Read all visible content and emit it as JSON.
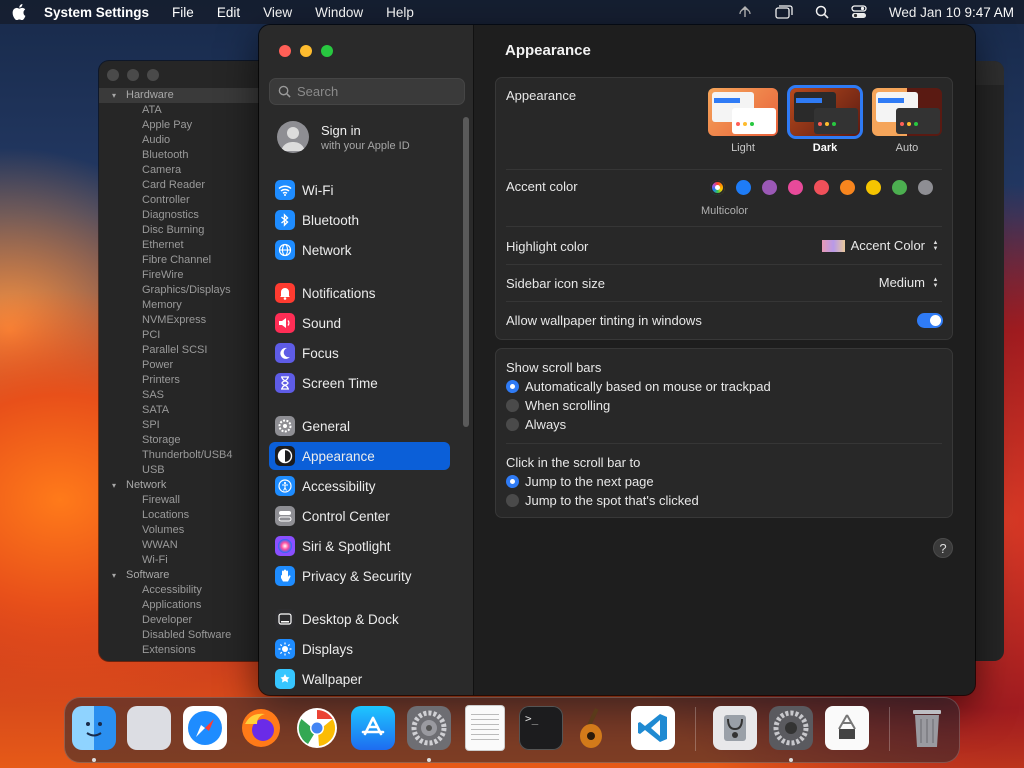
{
  "menubar": {
    "app_name": "System Settings",
    "menus": [
      "File",
      "Edit",
      "View",
      "Window",
      "Help"
    ],
    "clock": "Wed Jan 10  9:47 AM"
  },
  "system_info": {
    "sections": [
      {
        "label": "Hardware",
        "items": [
          "ATA",
          "Apple Pay",
          "Audio",
          "Bluetooth",
          "Camera",
          "Card Reader",
          "Controller",
          "Diagnostics",
          "Disc Burning",
          "Ethernet",
          "Fibre Channel",
          "FireWire",
          "Graphics/Displays",
          "Memory",
          "NVMExpress",
          "PCI",
          "Parallel SCSI",
          "Power",
          "Printers",
          "SAS",
          "SATA",
          "SPI",
          "Storage",
          "Thunderbolt/USB4",
          "USB"
        ]
      },
      {
        "label": "Network",
        "items": [
          "Firewall",
          "Locations",
          "Volumes",
          "WWAN",
          "Wi-Fi"
        ]
      },
      {
        "label": "Software",
        "items": [
          "Accessibility",
          "Applications",
          "Developer",
          "Disabled Software",
          "Extensions"
        ]
      }
    ]
  },
  "sidebar": {
    "search_placeholder": "Search",
    "account_title": "Sign in",
    "account_subtitle": "with your Apple ID",
    "items": [
      {
        "label": "Wi-Fi",
        "icon": "wifi-icon",
        "color": "#1e8cff"
      },
      {
        "label": "Bluetooth",
        "icon": "bluetooth-icon",
        "color": "#1e8cff"
      },
      {
        "label": "Network",
        "icon": "globe-icon",
        "color": "#1e8cff"
      },
      {
        "label": "Notifications",
        "icon": "bell-icon",
        "color": "#ff3b30"
      },
      {
        "label": "Sound",
        "icon": "speaker-icon",
        "color": "#ff2d55"
      },
      {
        "label": "Focus",
        "icon": "moon-icon",
        "color": "#5e5ce6"
      },
      {
        "label": "Screen Time",
        "icon": "hourglass-icon",
        "color": "#5e5ce6"
      },
      {
        "label": "General",
        "icon": "gear-icon",
        "color": "#8e8e93"
      },
      {
        "label": "Appearance",
        "icon": "appearance-icon",
        "color": "#1c1c1e"
      },
      {
        "label": "Accessibility",
        "icon": "accessibility-icon",
        "color": "#1e8cff"
      },
      {
        "label": "Control Center",
        "icon": "control-center-icon",
        "color": "#8e8e93"
      },
      {
        "label": "Siri & Spotlight",
        "icon": "siri-icon",
        "color": "#8a4fff"
      },
      {
        "label": "Privacy & Security",
        "icon": "hand-icon",
        "color": "#1e8cff"
      },
      {
        "label": "Desktop & Dock",
        "icon": "dock-icon",
        "color": "#2c2c2e"
      },
      {
        "label": "Displays",
        "icon": "sun-icon",
        "color": "#1e8cff"
      },
      {
        "label": "Wallpaper",
        "icon": "wallpaper-icon",
        "color": "#36c6ff"
      }
    ],
    "selected": "Appearance"
  },
  "content": {
    "title": "Appearance",
    "appearance_label": "Appearance",
    "appearance_options": [
      {
        "label": "Light",
        "selected": false
      },
      {
        "label": "Dark",
        "selected": true
      },
      {
        "label": "Auto",
        "selected": false
      }
    ],
    "accent_label": "Accent color",
    "accent_colors": [
      "multicolor",
      "#1e7cf7",
      "#9b59b6",
      "#e84a9a",
      "#f0505a",
      "#f7851e",
      "#f5c400",
      "#4caf50",
      "#8e8e93"
    ],
    "accent_selected_label": "Multicolor",
    "highlight_label": "Highlight color",
    "highlight_value": "Accent Color",
    "sidebar_icon_label": "Sidebar icon size",
    "sidebar_icon_value": "Medium",
    "tinting_label": "Allow wallpaper tinting in windows",
    "tinting_on": true,
    "scrollbars_label": "Show scroll bars",
    "scrollbars_options": [
      {
        "label": "Automatically based on mouse or trackpad",
        "selected": true
      },
      {
        "label": "When scrolling",
        "selected": false
      },
      {
        "label": "Always",
        "selected": false
      }
    ],
    "click_label": "Click in the scroll bar to",
    "click_options": [
      {
        "label": "Jump to the next page",
        "selected": true
      },
      {
        "label": "Jump to the spot that's clicked",
        "selected": false
      }
    ],
    "help": "?"
  },
  "dock": {
    "apps": [
      "Finder",
      "Launchpad",
      "Safari",
      "Firefox",
      "Chrome",
      "App Store",
      "System Preferences",
      "TextEdit",
      "Terminal",
      "GarageBand",
      "Visual Studio Code",
      "Disk Utility",
      "System Settings",
      "System Information",
      "Trash"
    ]
  }
}
